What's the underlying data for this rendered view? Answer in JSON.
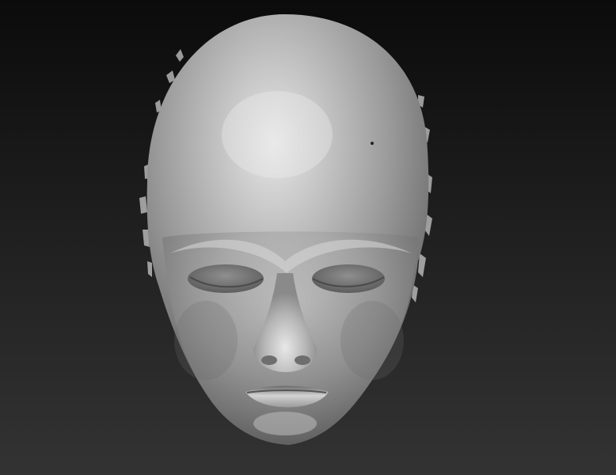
{
  "viewport": {
    "background_top": "#0b0b0b",
    "background_bottom": "#333333",
    "model_color": "#a6a6a6"
  },
  "model": {
    "subject": "head-scan",
    "material": "matte-gray",
    "view": "front"
  }
}
